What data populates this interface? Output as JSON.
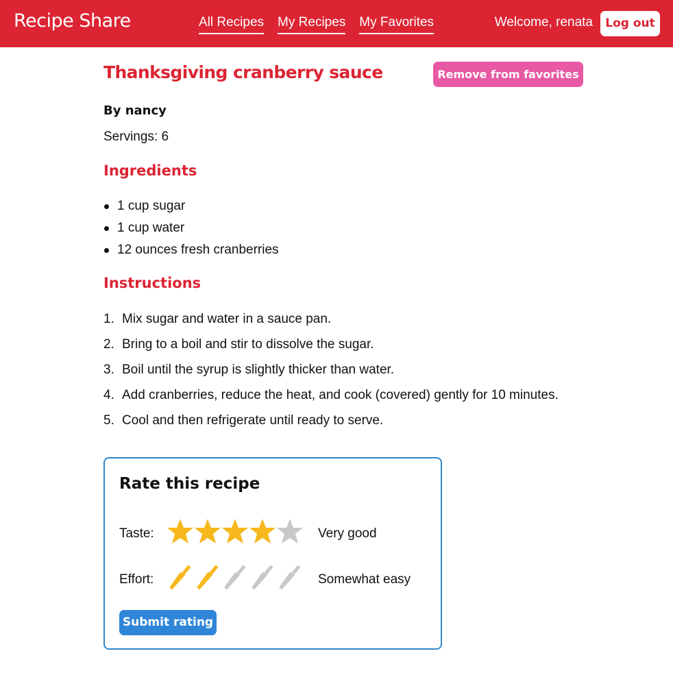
{
  "header": {
    "brand": "Recipe Share",
    "nav": [
      "All Recipes",
      "My Recipes",
      "My Favorites"
    ],
    "welcome": "Welcome, renata",
    "logout_label": "Log out"
  },
  "recipe": {
    "title": "Thanksgiving cranberry sauce",
    "favorite_button": "Remove from favorites",
    "author": "By nancy",
    "servings": "Servings: 6",
    "ingredients_heading": "Ingredients",
    "ingredients": [
      "1 cup sugar",
      "1 cup water",
      "12 ounces fresh cranberries"
    ],
    "instructions_heading": "Instructions",
    "instructions": [
      {
        "num": "1.",
        "text": "Mix sugar and water in a sauce pan."
      },
      {
        "num": "2.",
        "text": "Bring to a boil and stir to dissolve the sugar."
      },
      {
        "num": "3.",
        "text": "Boil until the syrup is slightly thicker than water."
      },
      {
        "num": "4.",
        "text": "Add cranberries, reduce the heat, and cook (covered) gently for 10 minutes."
      },
      {
        "num": "5.",
        "text": "Cool and then refrigerate until ready to serve."
      }
    ]
  },
  "rating": {
    "title": "Rate this recipe",
    "taste": {
      "label": "Taste:",
      "value": 4,
      "max": 5,
      "description": "Very good",
      "icon": "star-icon"
    },
    "effort": {
      "label": "Effort:",
      "value": 2,
      "max": 5,
      "description": "Somewhat easy",
      "icon": "knife-icon"
    },
    "submit_label": "Submit rating"
  },
  "colors": {
    "brand_red": "#dc2433",
    "favorite_pink": "#e75aa3",
    "accent_blue": "#2f86d9",
    "active_icon": "#f6b81c",
    "inactive_icon": "#c8c8c8"
  }
}
